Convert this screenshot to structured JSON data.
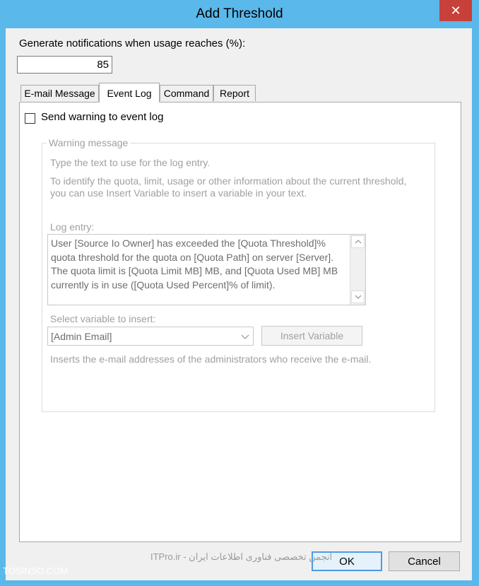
{
  "window": {
    "title": "Add Threshold",
    "close_glyph": "✕"
  },
  "threshold": {
    "label": "Generate notifications when usage reaches (%):",
    "value": "85"
  },
  "tabs": [
    {
      "label": "E-mail Message",
      "active": false
    },
    {
      "label": "Event Log",
      "active": true
    },
    {
      "label": "Command",
      "active": false
    },
    {
      "label": "Report",
      "active": false
    }
  ],
  "event_log": {
    "send_checkbox_label": "Send warning to event log",
    "send_checked": false,
    "group_title": "Warning message",
    "instruction_1": "Type the text to use for the log entry.",
    "instruction_2a": "To identify the quota, limit, usage or other information about the current threshold,",
    "instruction_2b": "you can use Insert Variable to insert a variable in your text.",
    "log_entry_label": "Log entry:",
    "log_entry_lines": [
      "User [Source Io Owner] has exceeded the [Quota Threshold]%",
      "quota threshold for the quota on [Quota Path] on server [Server].",
      "The quota limit is [Quota Limit MB] MB, and [Quota Used MB] MB",
      "currently is in use ([Quota Used Percent]% of limit)."
    ],
    "select_label": "Select variable to insert:",
    "select_value": "[Admin Email]",
    "insert_button": "Insert Variable",
    "variable_description": "Inserts the e-mail addresses of the administrators who receive the e-mail."
  },
  "buttons": {
    "ok": "OK",
    "cancel": "Cancel"
  },
  "watermarks": {
    "left": "TOSINSO.COM",
    "center": "ITPro.ir - انجمن تخصصی فناوری اطلاعات ایران"
  },
  "colors": {
    "frame": "#5ab8ea",
    "close": "#c7403a",
    "default_button_border": "#4e9be0"
  }
}
